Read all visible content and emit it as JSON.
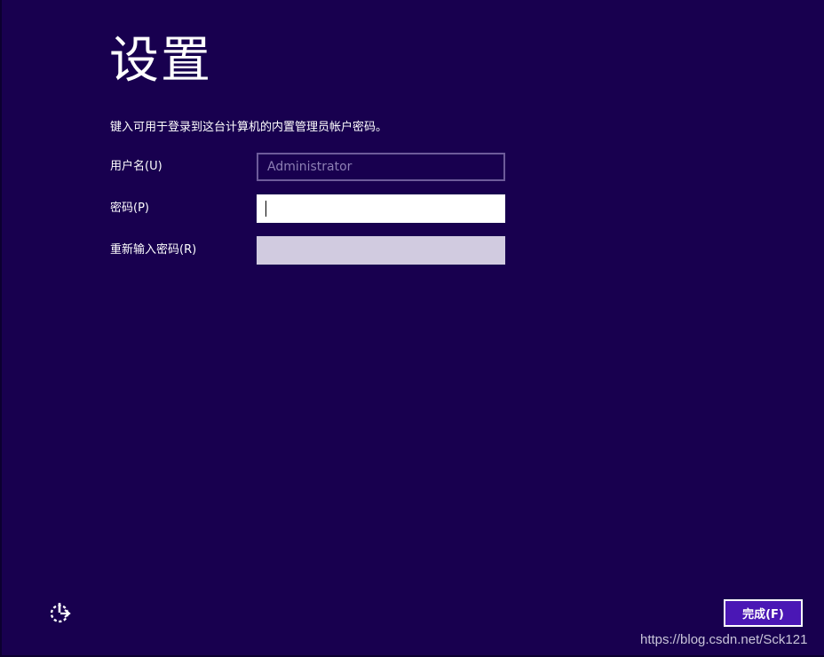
{
  "page": {
    "title": "设置",
    "instruction": "键入可用于登录到这台计算机的内置管理员帐户密码。"
  },
  "form": {
    "username": {
      "label": "用户名(U)",
      "placeholder": "Administrator",
      "value": ""
    },
    "password": {
      "label": "密码(P)",
      "value": ""
    },
    "reenter_password": {
      "label": "重新输入密码(R)",
      "value": ""
    }
  },
  "footer": {
    "accessibility_icon": "ease-of-access-icon",
    "finish_label": "完成(F)",
    "watermark": "https://blog.csdn.net/Sck121"
  },
  "colors": {
    "background": "#18004f",
    "button_accent": "#4a17b5",
    "disabled_field": "#d1cbe0",
    "text": "#ffffff"
  }
}
